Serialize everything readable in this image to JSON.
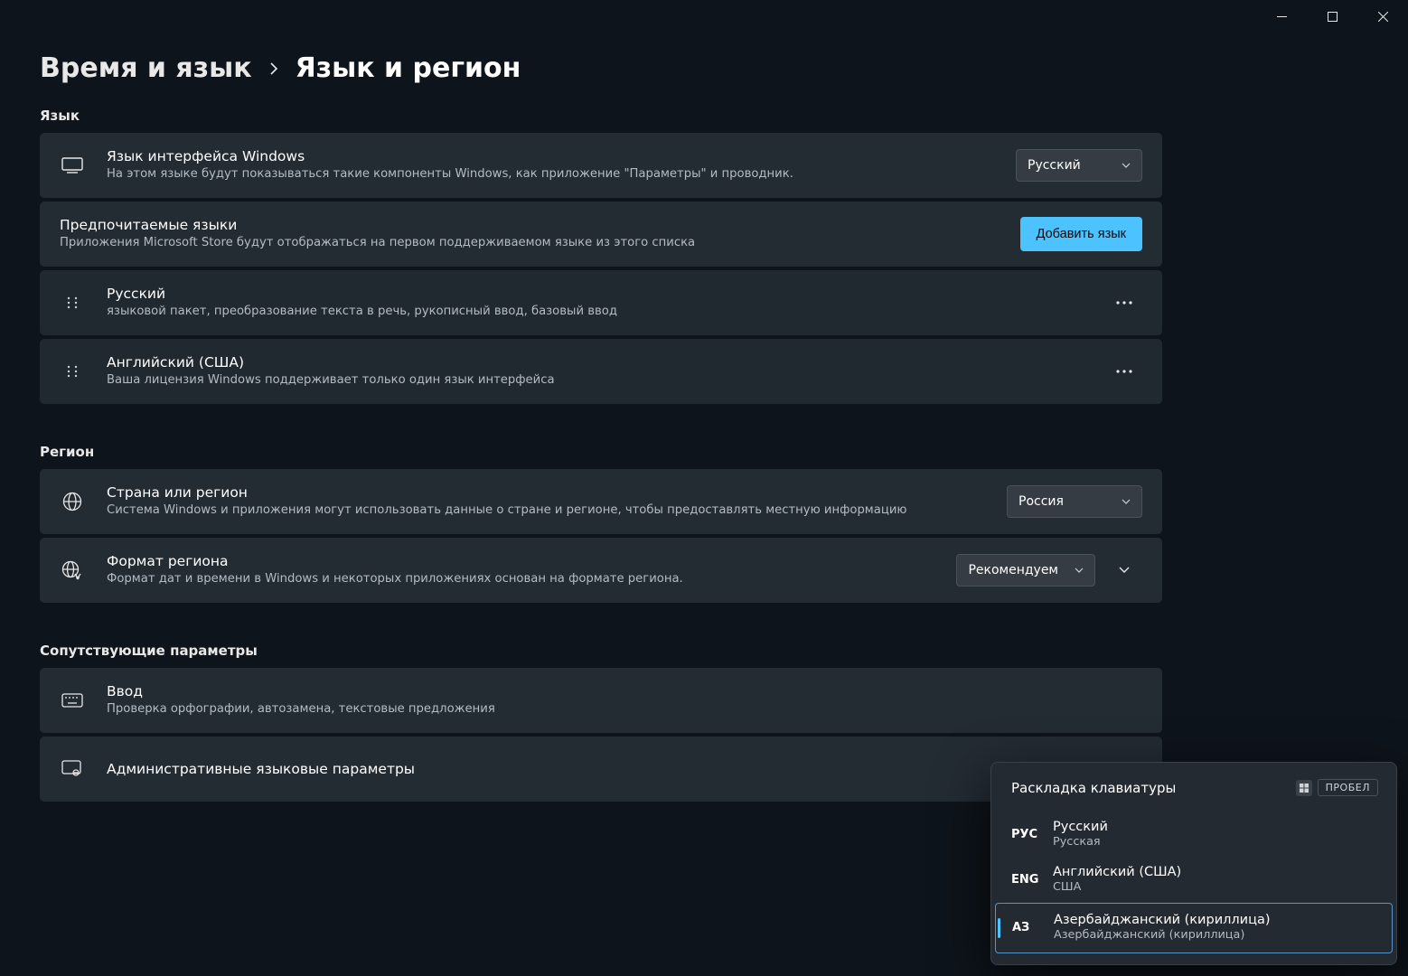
{
  "window": {
    "breadcrumb_parent": "Время и язык",
    "breadcrumb_current": "Язык и регион"
  },
  "sections": {
    "language_label": "Язык",
    "region_label": "Регион",
    "related_label": "Сопутствующие параметры"
  },
  "display_language": {
    "title": "Язык интерфейса Windows",
    "desc": "На этом языке будут показываться такие компоненты Windows, как приложение \"Параметры\" и проводник.",
    "selected": "Русский"
  },
  "preferred": {
    "title": "Предпочитаемые языки",
    "desc": "Приложения Microsoft Store будут отображаться на первом поддерживаемом языке из этого списка",
    "add_button": "Добавить язык"
  },
  "lang_items": [
    {
      "name": "Русский",
      "desc": "языковой пакет, преобразование текста в речь, рукописный ввод, базовый ввод"
    },
    {
      "name": "Английский (США)",
      "desc": "Ваша лицензия Windows поддерживает только один язык интерфейса"
    }
  ],
  "country": {
    "title": "Страна или регион",
    "desc": "Система Windows и приложения могут использовать данные о стране и регионе, чтобы предоставлять местную информацию",
    "selected": "Россия"
  },
  "region_format": {
    "title": "Формат региона",
    "desc": "Формат дат и времени в Windows и некоторых приложениях основан на формате региона.",
    "selected": "Рекомендуем"
  },
  "typing": {
    "title": "Ввод",
    "desc": "Проверка орфографии, автозамена, текстовые предложения"
  },
  "admin": {
    "title": "Административные языковые параметры"
  },
  "kb_flyout": {
    "header": "Раскладка клавиатуры",
    "space_key": "ПРОБЕЛ",
    "items": [
      {
        "abbr": "РУС",
        "name": "Русский",
        "sub": "Русская",
        "selected": false
      },
      {
        "abbr": "ENG",
        "name": "Английский (США)",
        "sub": "США",
        "selected": false
      },
      {
        "abbr": "АЗ",
        "name": "Азербайджанский (кириллица)",
        "sub": "Азербайджанский (кириллица)",
        "selected": true
      }
    ]
  }
}
